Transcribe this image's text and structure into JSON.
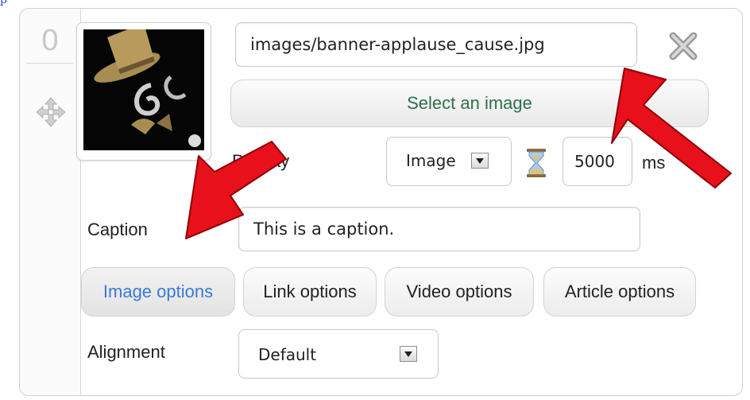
{
  "slide": {
    "order_number": "0",
    "image_path": "images/banner-applause_cause.jpg",
    "select_image_label": "Select an image",
    "display_label": "Display",
    "display_value": "Image",
    "duration_value": "5000",
    "duration_unit": "ms",
    "caption_label": "Caption",
    "caption_value": "This is a caption.",
    "tabs": [
      {
        "label": "Image options",
        "active": true
      },
      {
        "label": "Link options",
        "active": false
      },
      {
        "label": "Video options",
        "active": false
      },
      {
        "label": "Article options",
        "active": false
      }
    ],
    "alignment_label": "Alignment",
    "alignment_value": "Default"
  },
  "top_link_text": "p",
  "colors": {
    "active_tab_text": "#3b79d4",
    "select_button_text": "#2f6f4e",
    "annotation_arrow": "#e8101a"
  },
  "icons": [
    "move-icon",
    "close-icon",
    "hourglass-icon",
    "dropdown-arrow-icon"
  ]
}
